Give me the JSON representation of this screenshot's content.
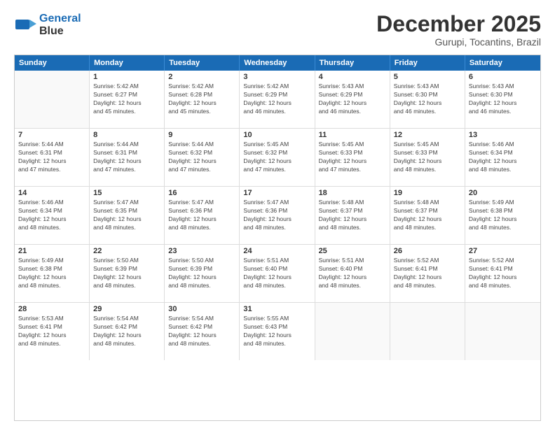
{
  "header": {
    "logo_line1": "General",
    "logo_line2": "Blue",
    "month": "December 2025",
    "location": "Gurupi, Tocantins, Brazil"
  },
  "weekdays": [
    "Sunday",
    "Monday",
    "Tuesday",
    "Wednesday",
    "Thursday",
    "Friday",
    "Saturday"
  ],
  "rows": [
    [
      {
        "date": "",
        "info": ""
      },
      {
        "date": "1",
        "info": "Sunrise: 5:42 AM\nSunset: 6:27 PM\nDaylight: 12 hours\nand 45 minutes."
      },
      {
        "date": "2",
        "info": "Sunrise: 5:42 AM\nSunset: 6:28 PM\nDaylight: 12 hours\nand 45 minutes."
      },
      {
        "date": "3",
        "info": "Sunrise: 5:42 AM\nSunset: 6:29 PM\nDaylight: 12 hours\nand 46 minutes."
      },
      {
        "date": "4",
        "info": "Sunrise: 5:43 AM\nSunset: 6:29 PM\nDaylight: 12 hours\nand 46 minutes."
      },
      {
        "date": "5",
        "info": "Sunrise: 5:43 AM\nSunset: 6:30 PM\nDaylight: 12 hours\nand 46 minutes."
      },
      {
        "date": "6",
        "info": "Sunrise: 5:43 AM\nSunset: 6:30 PM\nDaylight: 12 hours\nand 46 minutes."
      }
    ],
    [
      {
        "date": "7",
        "info": "Sunrise: 5:44 AM\nSunset: 6:31 PM\nDaylight: 12 hours\nand 47 minutes."
      },
      {
        "date": "8",
        "info": "Sunrise: 5:44 AM\nSunset: 6:31 PM\nDaylight: 12 hours\nand 47 minutes."
      },
      {
        "date": "9",
        "info": "Sunrise: 5:44 AM\nSunset: 6:32 PM\nDaylight: 12 hours\nand 47 minutes."
      },
      {
        "date": "10",
        "info": "Sunrise: 5:45 AM\nSunset: 6:32 PM\nDaylight: 12 hours\nand 47 minutes."
      },
      {
        "date": "11",
        "info": "Sunrise: 5:45 AM\nSunset: 6:33 PM\nDaylight: 12 hours\nand 47 minutes."
      },
      {
        "date": "12",
        "info": "Sunrise: 5:45 AM\nSunset: 6:33 PM\nDaylight: 12 hours\nand 48 minutes."
      },
      {
        "date": "13",
        "info": "Sunrise: 5:46 AM\nSunset: 6:34 PM\nDaylight: 12 hours\nand 48 minutes."
      }
    ],
    [
      {
        "date": "14",
        "info": "Sunrise: 5:46 AM\nSunset: 6:34 PM\nDaylight: 12 hours\nand 48 minutes."
      },
      {
        "date": "15",
        "info": "Sunrise: 5:47 AM\nSunset: 6:35 PM\nDaylight: 12 hours\nand 48 minutes."
      },
      {
        "date": "16",
        "info": "Sunrise: 5:47 AM\nSunset: 6:36 PM\nDaylight: 12 hours\nand 48 minutes."
      },
      {
        "date": "17",
        "info": "Sunrise: 5:47 AM\nSunset: 6:36 PM\nDaylight: 12 hours\nand 48 minutes."
      },
      {
        "date": "18",
        "info": "Sunrise: 5:48 AM\nSunset: 6:37 PM\nDaylight: 12 hours\nand 48 minutes."
      },
      {
        "date": "19",
        "info": "Sunrise: 5:48 AM\nSunset: 6:37 PM\nDaylight: 12 hours\nand 48 minutes."
      },
      {
        "date": "20",
        "info": "Sunrise: 5:49 AM\nSunset: 6:38 PM\nDaylight: 12 hours\nand 48 minutes."
      }
    ],
    [
      {
        "date": "21",
        "info": "Sunrise: 5:49 AM\nSunset: 6:38 PM\nDaylight: 12 hours\nand 48 minutes."
      },
      {
        "date": "22",
        "info": "Sunrise: 5:50 AM\nSunset: 6:39 PM\nDaylight: 12 hours\nand 48 minutes."
      },
      {
        "date": "23",
        "info": "Sunrise: 5:50 AM\nSunset: 6:39 PM\nDaylight: 12 hours\nand 48 minutes."
      },
      {
        "date": "24",
        "info": "Sunrise: 5:51 AM\nSunset: 6:40 PM\nDaylight: 12 hours\nand 48 minutes."
      },
      {
        "date": "25",
        "info": "Sunrise: 5:51 AM\nSunset: 6:40 PM\nDaylight: 12 hours\nand 48 minutes."
      },
      {
        "date": "26",
        "info": "Sunrise: 5:52 AM\nSunset: 6:41 PM\nDaylight: 12 hours\nand 48 minutes."
      },
      {
        "date": "27",
        "info": "Sunrise: 5:52 AM\nSunset: 6:41 PM\nDaylight: 12 hours\nand 48 minutes."
      }
    ],
    [
      {
        "date": "28",
        "info": "Sunrise: 5:53 AM\nSunset: 6:41 PM\nDaylight: 12 hours\nand 48 minutes."
      },
      {
        "date": "29",
        "info": "Sunrise: 5:54 AM\nSunset: 6:42 PM\nDaylight: 12 hours\nand 48 minutes."
      },
      {
        "date": "30",
        "info": "Sunrise: 5:54 AM\nSunset: 6:42 PM\nDaylight: 12 hours\nand 48 minutes."
      },
      {
        "date": "31",
        "info": "Sunrise: 5:55 AM\nSunset: 6:43 PM\nDaylight: 12 hours\nand 48 minutes."
      },
      {
        "date": "",
        "info": ""
      },
      {
        "date": "",
        "info": ""
      },
      {
        "date": "",
        "info": ""
      }
    ]
  ]
}
